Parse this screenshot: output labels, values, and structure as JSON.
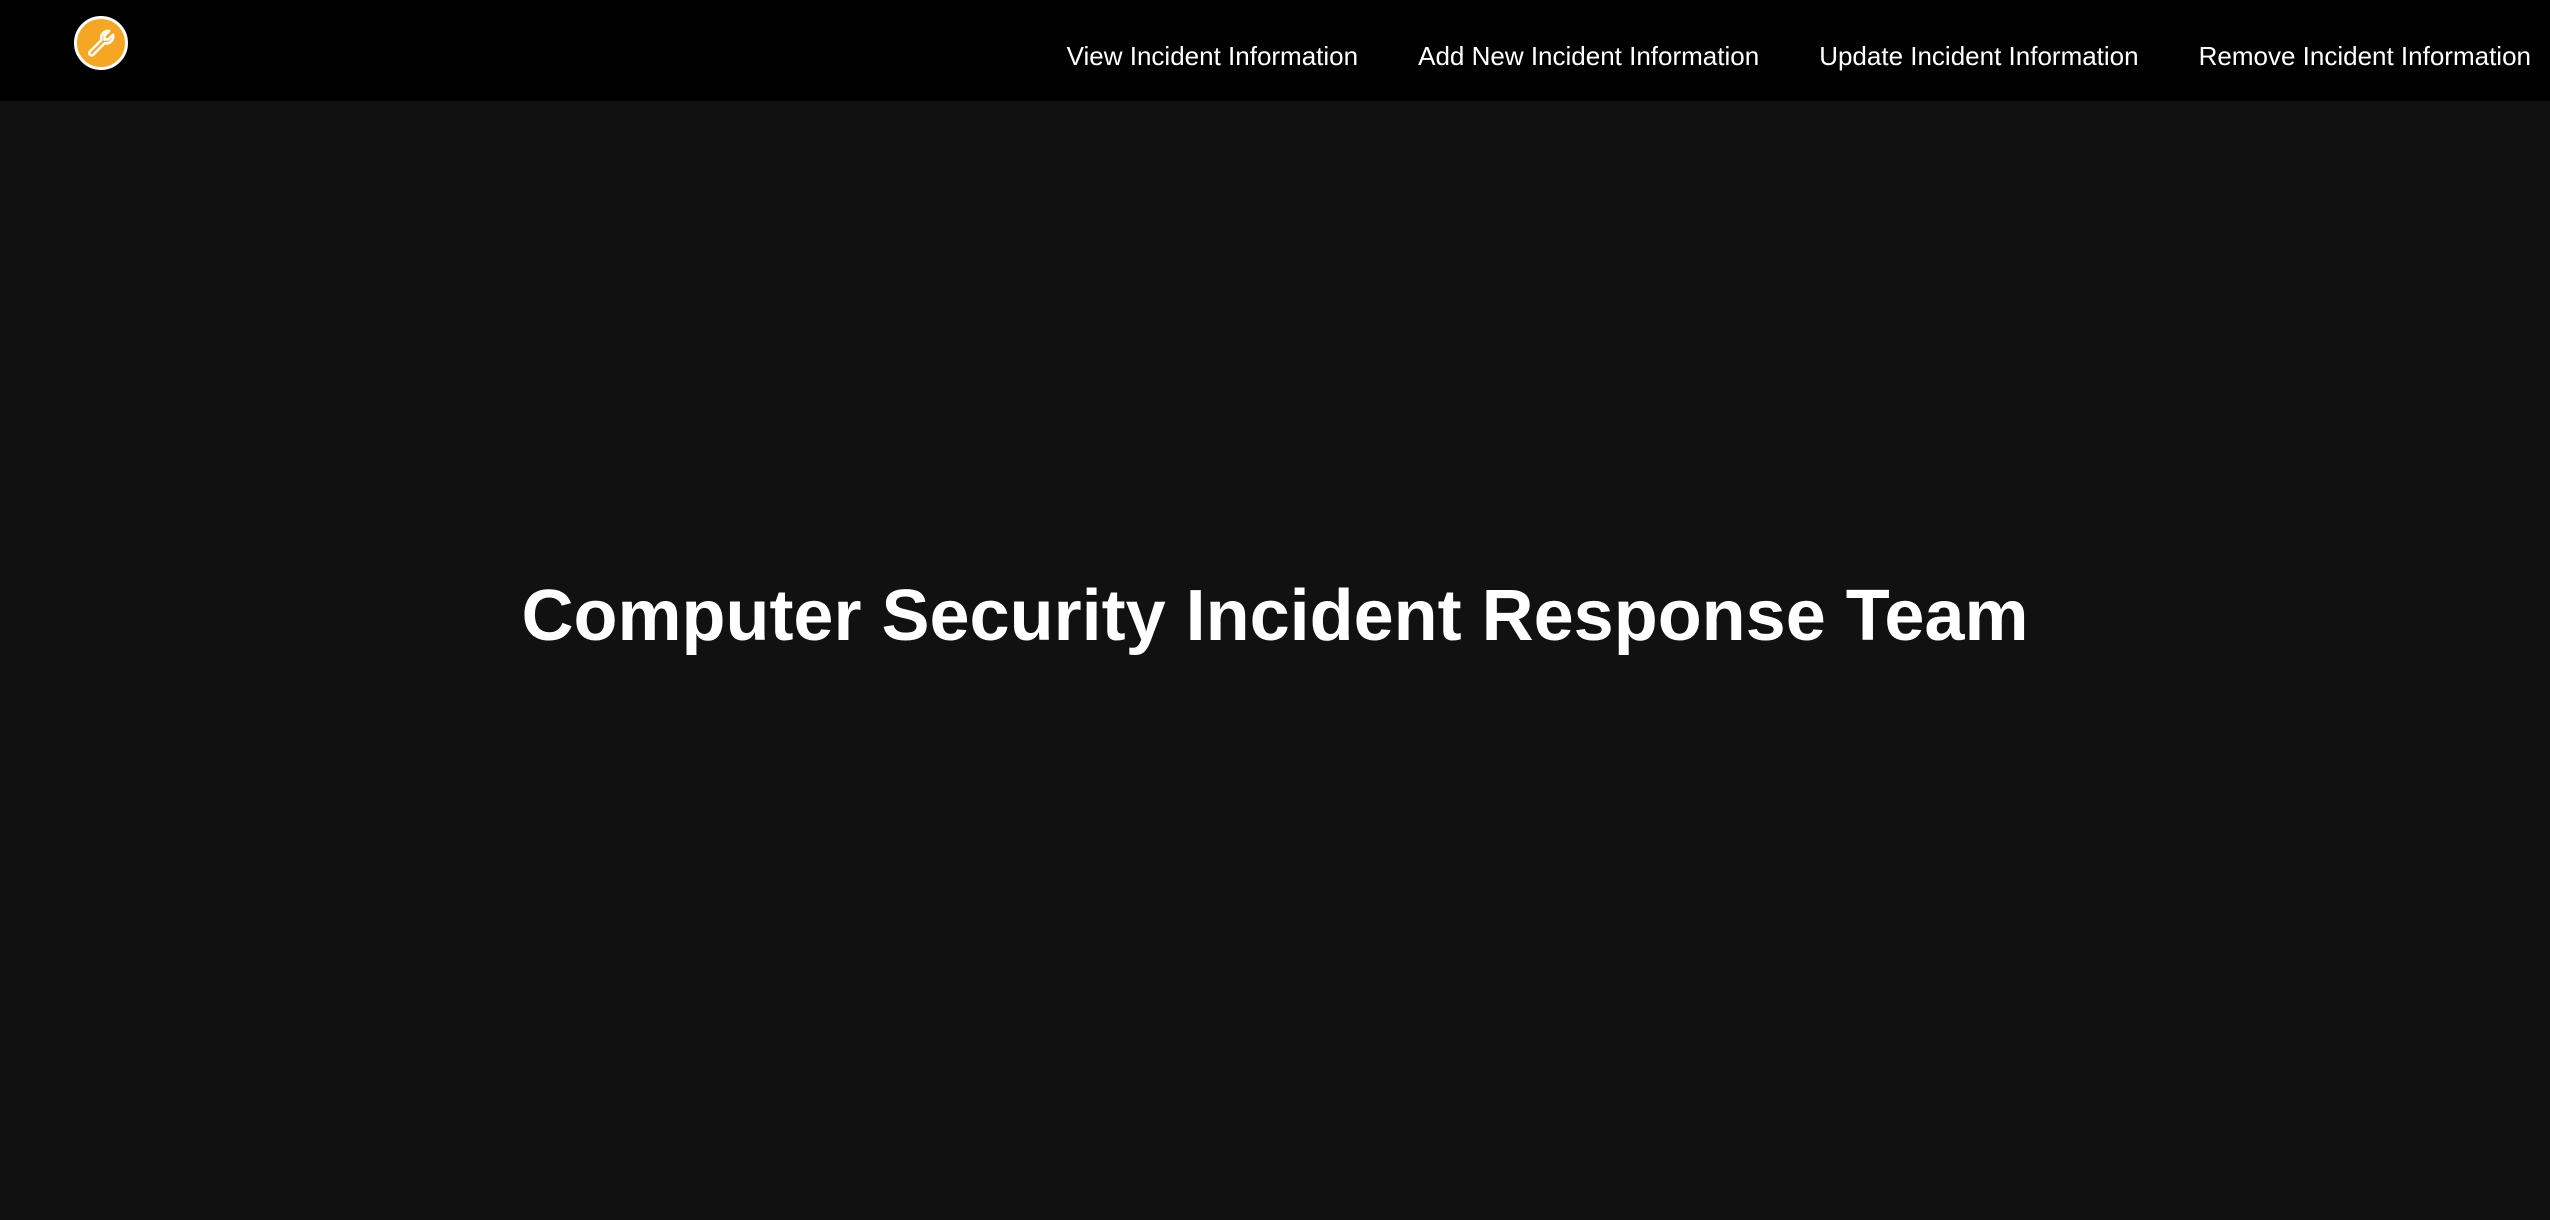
{
  "header": {
    "logo_icon": "wrench-icon",
    "logo_color": "#f5a623",
    "background_color": "#000000"
  },
  "nav": {
    "items": [
      {
        "label": "View Incident Information"
      },
      {
        "label": "Add New Incident Information"
      },
      {
        "label": "Update Incident Information"
      },
      {
        "label": "Remove Incident Information"
      }
    ]
  },
  "main": {
    "title": "Computer Security Incident Response Team",
    "background_color": "#111111"
  }
}
